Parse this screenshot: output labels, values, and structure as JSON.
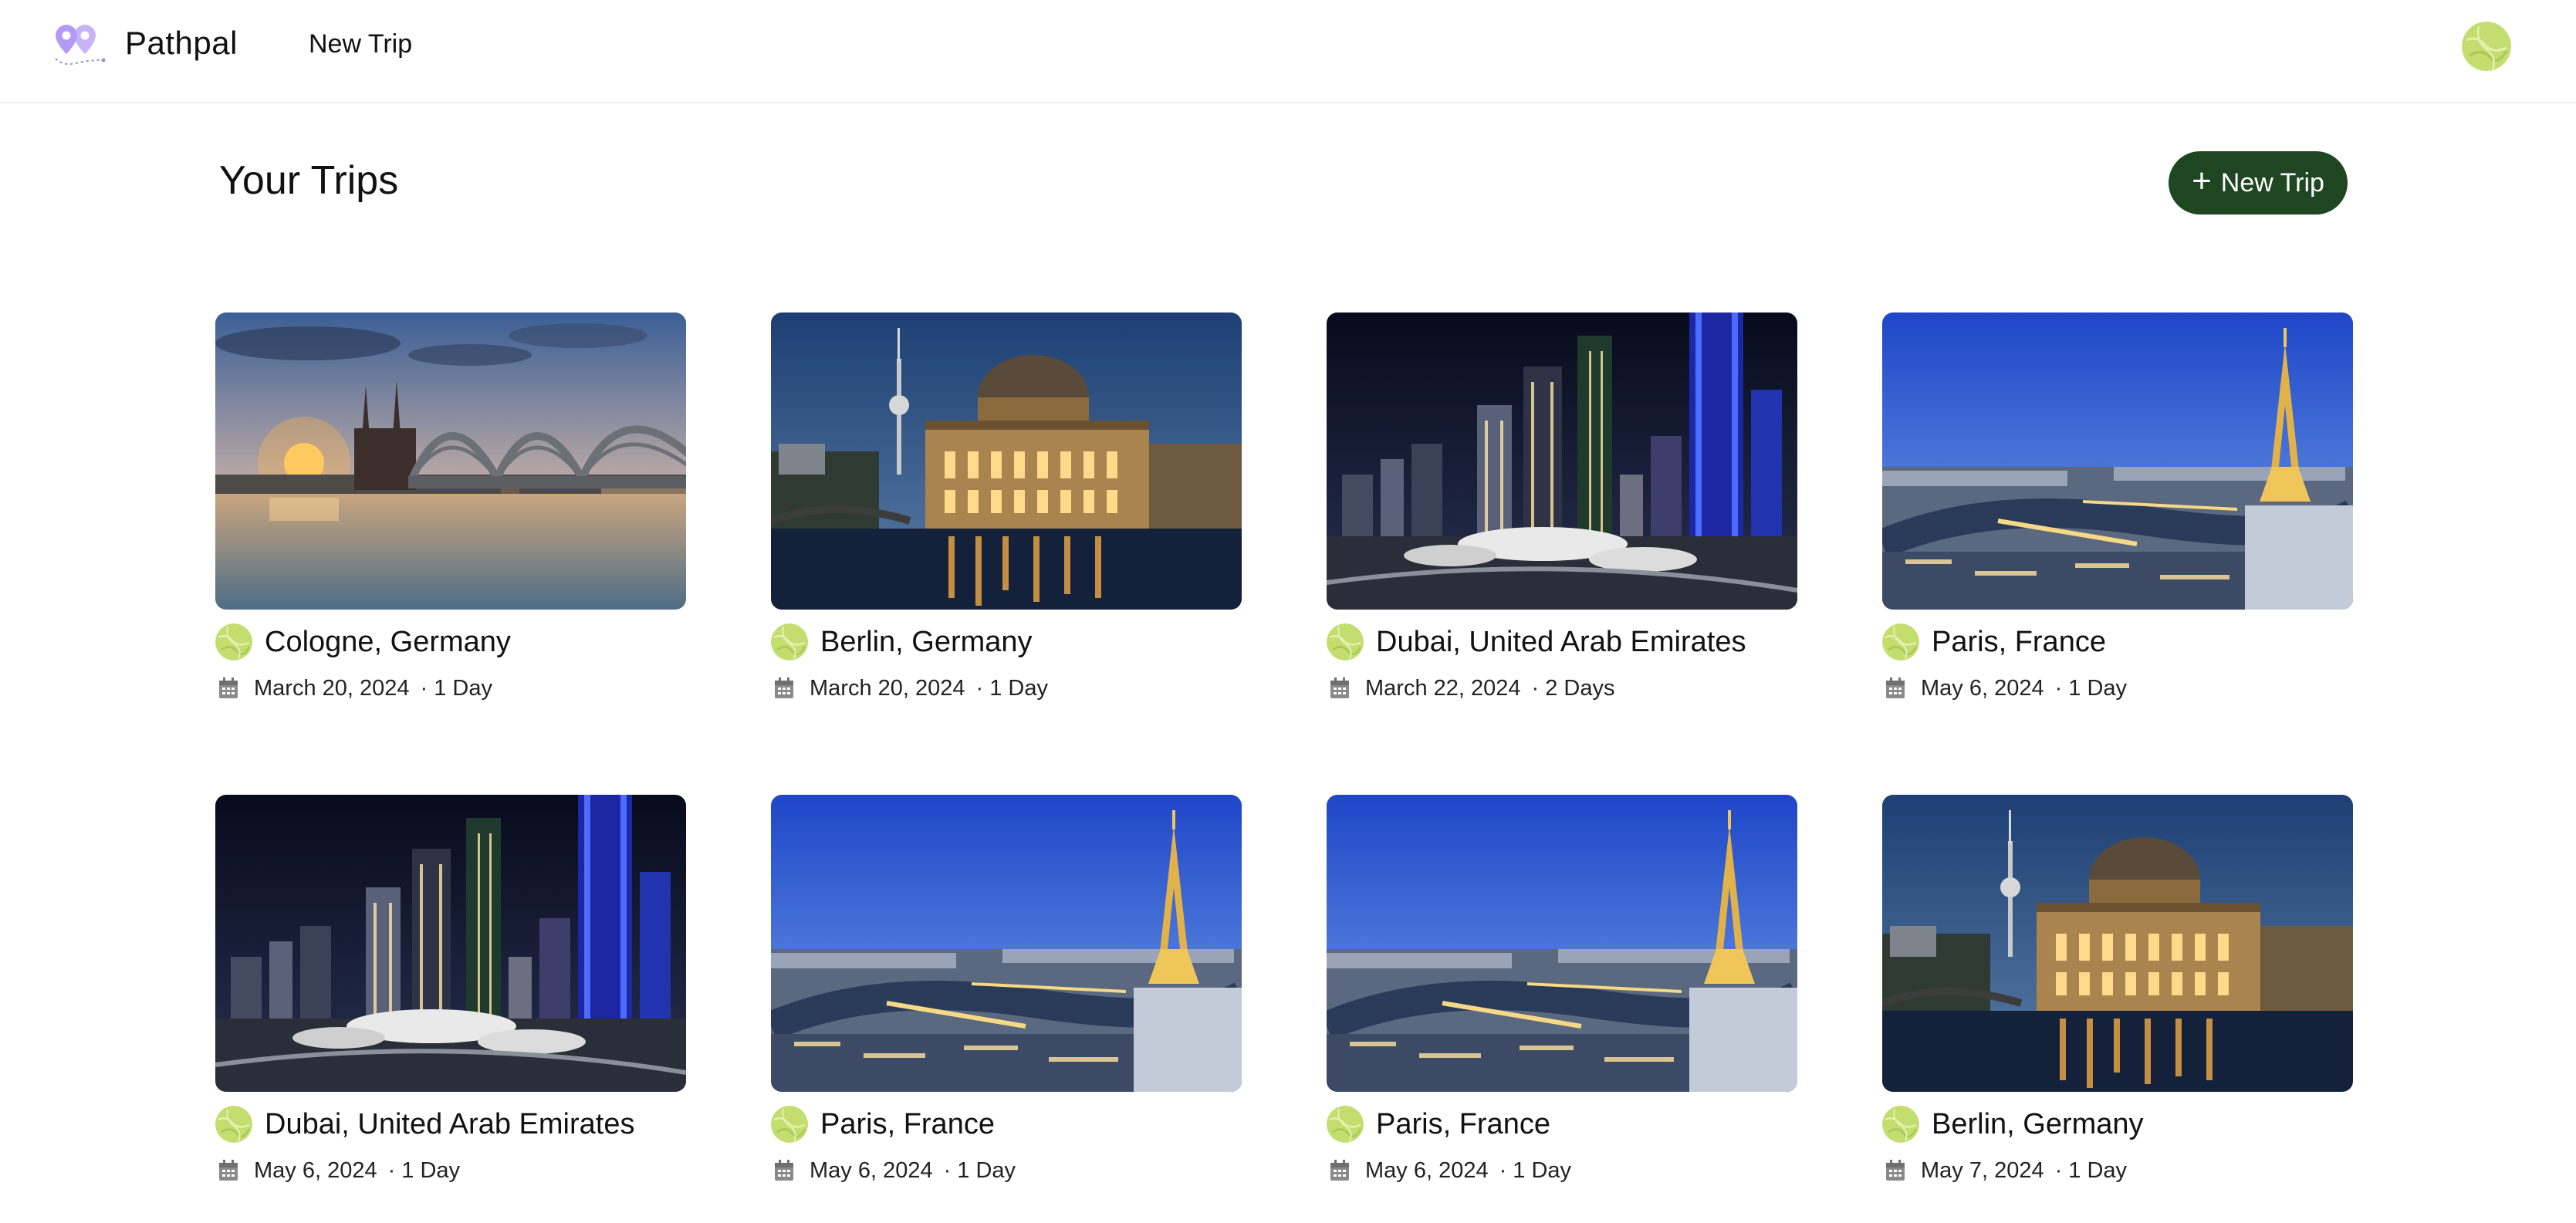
{
  "app": {
    "brand": "Pathpal",
    "nav_new_trip": "New Trip"
  },
  "page": {
    "title": "Your Trips",
    "new_trip_button": "New Trip"
  },
  "colors": {
    "primary": "#1e4620",
    "avatar": "#c3dd6f",
    "logo": "#b59af5"
  },
  "icons": {
    "plus": "plus-icon",
    "calendar": "calendar-icon",
    "logo": "pathpal-logo",
    "avatar": "avatar"
  },
  "trips": [
    {
      "destination": "Cologne, Germany",
      "date": "March 20, 2024",
      "duration": "1 Day",
      "scene": "cologne"
    },
    {
      "destination": "Berlin, Germany",
      "date": "March 20, 2024",
      "duration": "1 Day",
      "scene": "berlin"
    },
    {
      "destination": "Dubai, United Arab Emirates",
      "date": "March 22, 2024",
      "duration": "2 Days",
      "scene": "dubai"
    },
    {
      "destination": "Paris, France",
      "date": "May 6, 2024",
      "duration": "1 Day",
      "scene": "paris"
    },
    {
      "destination": "Dubai, United Arab Emirates",
      "date": "May 6, 2024",
      "duration": "1 Day",
      "scene": "dubai"
    },
    {
      "destination": "Paris, France",
      "date": "May 6, 2024",
      "duration": "1 Day",
      "scene": "paris"
    },
    {
      "destination": "Paris, France",
      "date": "May 6, 2024",
      "duration": "1 Day",
      "scene": "paris"
    },
    {
      "destination": "Berlin, Germany",
      "date": "May 7, 2024",
      "duration": "1 Day",
      "scene": "berlin"
    }
  ]
}
